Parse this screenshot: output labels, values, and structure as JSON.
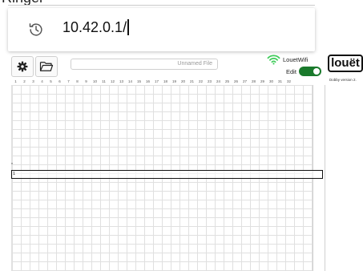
{
  "top_cutoff_text": "Ringer",
  "address_bar": {
    "url": "10.42.0.1/",
    "history_icon": "history-icon"
  },
  "toolbar": {
    "settings_icon": "gear-icon",
    "open_icon": "folder-open-icon",
    "filename_placeholder": "Unnamed File"
  },
  "status": {
    "wifi_icon": "wifi-icon",
    "wifi_name": "LouetWifi",
    "edit_label": "Edit",
    "edit_enabled": true,
    "accent_color": "#1a7a2c",
    "wifi_color": "#3fcc5a"
  },
  "brand": {
    "logo_text": "louët",
    "version": "Dobby version 2."
  },
  "grid": {
    "columns": [
      "1",
      "2",
      "3",
      "4",
      "5",
      "6",
      "7",
      "8",
      "9",
      "10",
      "11",
      "12",
      "13",
      "14",
      "15",
      "16",
      "17",
      "18",
      "19",
      "20",
      "21",
      "22",
      "23",
      "24",
      "25",
      "26",
      "27",
      "28",
      "29",
      "30",
      "31",
      "32"
    ],
    "row_marker": "*",
    "selected_row_number": "1"
  }
}
